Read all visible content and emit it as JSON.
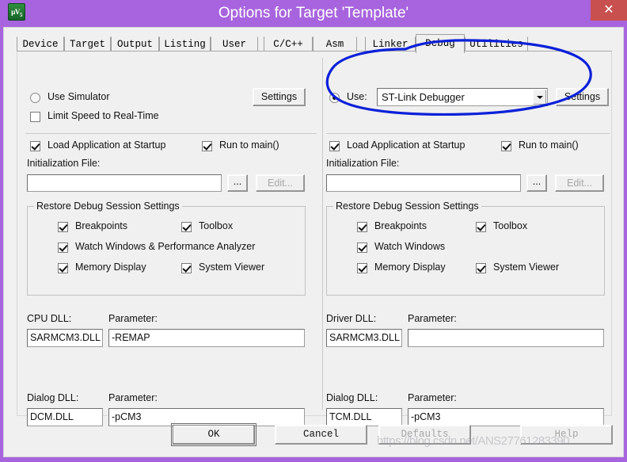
{
  "window": {
    "title": "Options for Target 'Template'",
    "app_icon": "uvision-logo-icon",
    "close_label": "✕",
    "titlebar_color": "#a764de",
    "close_color": "#c8504f"
  },
  "tabs": [
    {
      "label": "Device",
      "active": false
    },
    {
      "label": "Target",
      "active": false
    },
    {
      "label": "Output",
      "active": false
    },
    {
      "label": "Listing",
      "active": false
    },
    {
      "label": "User",
      "active": false
    },
    {
      "label": "C/C++",
      "active": false
    },
    {
      "label": "Asm",
      "active": false
    },
    {
      "label": "Linker",
      "active": false
    },
    {
      "label": "Debug",
      "active": true
    },
    {
      "label": "Utilities",
      "active": false
    }
  ],
  "left_panel": {
    "mode_radio_label": "Use Simulator",
    "mode_radio_checked": false,
    "settings_button": "Settings",
    "limit_speed_label": "Limit Speed to Real-Time",
    "limit_speed_checked": false,
    "load_app_label": "Load Application at Startup",
    "load_app_checked": true,
    "run_to_main_label": "Run to main()",
    "run_to_main_checked": true,
    "init_file_label": "Initialization File:",
    "init_file_value": "",
    "browse_button": "...",
    "edit_button": "Edit...",
    "edit_enabled": false,
    "restore_group_title": "Restore Debug Session Settings",
    "restore_items": [
      {
        "label": "Breakpoints",
        "checked": true
      },
      {
        "label": "Toolbox",
        "checked": true
      },
      {
        "label": "Watch Windows & Performance Analyzer",
        "checked": true
      },
      {
        "label": "Memory Display",
        "checked": true
      },
      {
        "label": "System Viewer",
        "checked": true
      }
    ],
    "dll_label": "CPU DLL:",
    "dll_value": "SARMCM3.DLL",
    "dll_param_label": "Parameter:",
    "dll_param_value": "-REMAP",
    "dialog_dll_label": "Dialog DLL:",
    "dialog_dll_value": "DCM.DLL",
    "dialog_param_label": "Parameter:",
    "dialog_param_value": "-pCM3"
  },
  "right_panel": {
    "mode_radio_label": "Use:",
    "mode_radio_checked": true,
    "debugger_selected": "ST-Link Debugger",
    "settings_button": "Settings",
    "load_app_label": "Load Application at Startup",
    "load_app_checked": true,
    "run_to_main_label": "Run to main()",
    "run_to_main_checked": true,
    "init_file_label": "Initialization File:",
    "init_file_value": "",
    "browse_button": "...",
    "edit_button": "Edit...",
    "edit_enabled": false,
    "restore_group_title": "Restore Debug Session Settings",
    "restore_items": [
      {
        "label": "Breakpoints",
        "checked": true
      },
      {
        "label": "Toolbox",
        "checked": true
      },
      {
        "label": "Watch Windows",
        "checked": true
      },
      {
        "label": "Memory Display",
        "checked": true
      },
      {
        "label": "System Viewer",
        "checked": true
      }
    ],
    "dll_label": "Driver DLL:",
    "dll_value": "SARMCM3.DLL",
    "dll_param_label": "Parameter:",
    "dll_param_value": "",
    "dialog_dll_label": "Dialog DLL:",
    "dialog_dll_value": "TCM.DLL",
    "dialog_param_label": "Parameter:",
    "dialog_param_value": "-pCM3"
  },
  "footer": {
    "ok": "OK",
    "cancel": "Cancel",
    "defaults": "Defaults",
    "help": "Help"
  },
  "annotation": {
    "type": "hand-drawn-ellipse",
    "color": "#0b20d8",
    "target": "debugger-select-combo"
  },
  "watermark": {
    "text": "https://blog.csdn.net/ANS27761283390"
  }
}
